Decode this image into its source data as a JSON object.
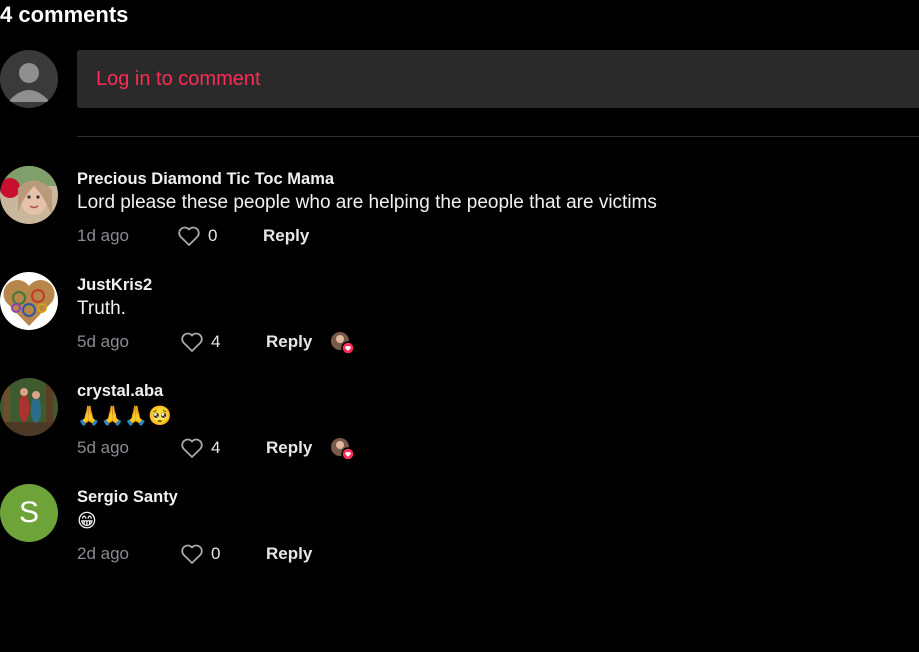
{
  "header": {
    "title": "4 comments"
  },
  "composer": {
    "login_label": "Log in to comment",
    "accent_color": "#fe2c55"
  },
  "comments": [
    {
      "username": "Precious Diamond Tic Toc Mama",
      "text": "Lord please these people who are helping the people that are victims",
      "time": "1d ago",
      "likes": "0",
      "reply_label": "Reply",
      "avatar": "photo-avatar",
      "liked_by_creator": false
    },
    {
      "username": "JustKris2",
      "text": "Truth.",
      "time": "5d ago",
      "likes": "4",
      "reply_label": "Reply",
      "avatar": "peace-heart-avatar",
      "liked_by_creator": true
    },
    {
      "username": "crystal.aba",
      "text": "🙏🙏🙏🥺",
      "time": "5d ago",
      "likes": "4",
      "reply_label": "Reply",
      "avatar": "forest-photo-avatar",
      "liked_by_creator": true
    },
    {
      "username": "Sergio Santy",
      "text": "😁",
      "time": "2d ago",
      "likes": "0",
      "reply_label": "Reply",
      "avatar_initial": "S",
      "avatar_color": "#6ea33a",
      "liked_by_creator": false
    }
  ]
}
